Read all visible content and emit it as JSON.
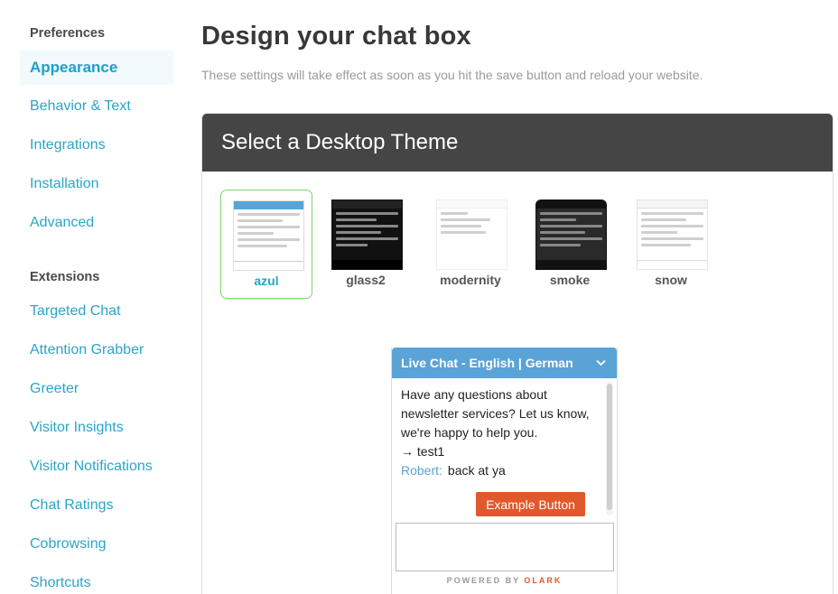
{
  "sidebar": {
    "preferences_heading": "Preferences",
    "preferences": [
      {
        "label": "Appearance",
        "active": true
      },
      {
        "label": "Behavior & Text"
      },
      {
        "label": "Integrations"
      },
      {
        "label": "Installation"
      },
      {
        "label": "Advanced"
      }
    ],
    "extensions_heading": "Extensions",
    "extensions": [
      {
        "label": "Targeted Chat"
      },
      {
        "label": "Attention Grabber"
      },
      {
        "label": "Greeter"
      },
      {
        "label": "Visitor Insights"
      },
      {
        "label": "Visitor Notifications"
      },
      {
        "label": "Chat Ratings"
      },
      {
        "label": "Cobrowsing"
      },
      {
        "label": "Shortcuts"
      }
    ]
  },
  "main": {
    "title": "Design your chat box",
    "subtitle": "These settings will take effect as soon as you hit the save button and reload your website.",
    "panel_title": "Select a Desktop Theme",
    "themes": [
      {
        "name": "azul",
        "selected": true
      },
      {
        "name": "glass2"
      },
      {
        "name": "modernity"
      },
      {
        "name": "smoke"
      },
      {
        "name": "snow"
      }
    ]
  },
  "chat_preview": {
    "header": "Live Chat - English | German",
    "message": "Have any questions about newsletter services? Let us know, we're happy to help you.",
    "visitor_line": "→ test1",
    "operator_name": "Robert:",
    "operator_message": "back at ya",
    "button_label": "Example Button",
    "powered_prefix": "POWERED BY",
    "powered_brand": "OLARK"
  },
  "colors": {
    "accent": "#2aa5c9",
    "header_dark": "#454545",
    "chat_header": "#5aa3d6",
    "button": "#e0582c",
    "selected_border": "#7ed36f"
  },
  "icons": {
    "chat_toggle": "chevron-down-icon"
  }
}
